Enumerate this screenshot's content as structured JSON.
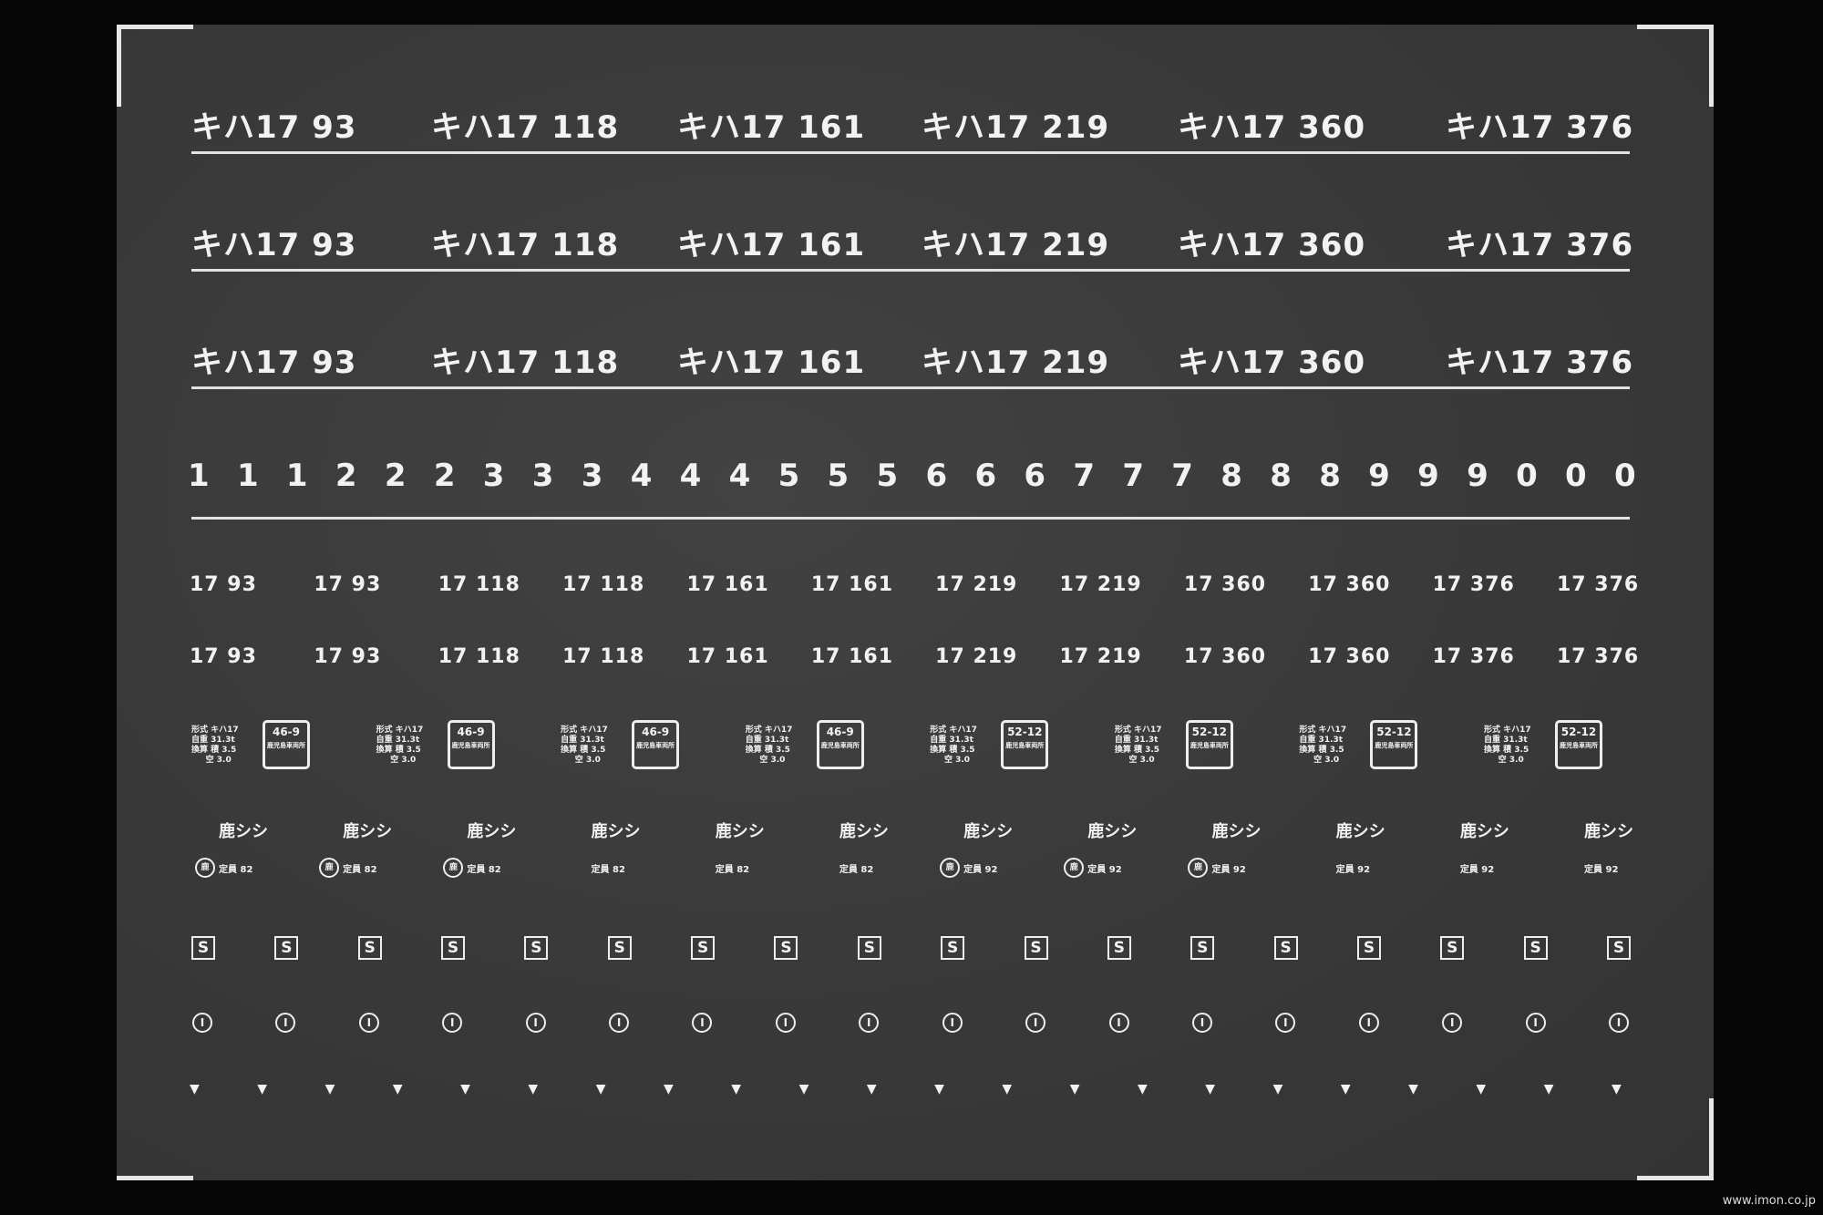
{
  "name_rows": [
    [
      "キハ17 93",
      "キハ17 118",
      "キハ17 161",
      "キハ17 219",
      "キハ17 360",
      "キハ17 376"
    ],
    [
      "キハ17 93",
      "キハ17 118",
      "キハ17 161",
      "キハ17 219",
      "キハ17 360",
      "キハ17 376"
    ],
    [
      "キハ17 93",
      "キハ17 118",
      "キハ17 161",
      "キハ17 219",
      "キハ17 360",
      "キハ17 376"
    ]
  ],
  "digits": [
    "1",
    "1",
    "1",
    "2",
    "2",
    "2",
    "3",
    "3",
    "3",
    "4",
    "4",
    "4",
    "5",
    "5",
    "5",
    "6",
    "6",
    "6",
    "7",
    "7",
    "7",
    "8",
    "8",
    "8",
    "9",
    "9",
    "9",
    "0",
    "0",
    "0"
  ],
  "small_rows": [
    [
      "17 93",
      "17 93",
      "17 118",
      "17 118",
      "17 161",
      "17 161",
      "17 219",
      "17 219",
      "17 360",
      "17 360",
      "17 376",
      "17 376"
    ],
    [
      "17 93",
      "17 93",
      "17 118",
      "17 118",
      "17 161",
      "17 161",
      "17 219",
      "17 219",
      "17 360",
      "17 360",
      "17 376",
      "17 376"
    ]
  ],
  "spec_plates": [
    {
      "text": "形式 キハ17\n自重 31.3t\n換算 積 3.5\n     空 3.0",
      "code": "46-9",
      "sub": "鹿児島車両所"
    },
    {
      "text": "形式 キハ17\n自重 31.3t\n換算 積 3.5\n     空 3.0",
      "code": "46-9",
      "sub": "鹿児島車両所"
    },
    {
      "text": "形式 キハ17\n自重 31.3t\n換算 積 3.5\n     空 3.0",
      "code": "46-9",
      "sub": "鹿児島車両所"
    },
    {
      "text": "形式 キハ17\n自重 31.3t\n換算 積 3.5\n     空 3.0",
      "code": "46-9",
      "sub": "鹿児島車両所"
    },
    {
      "text": "形式 キハ17\n自重 31.3t\n換算 積 3.5\n     空 3.0",
      "code": "52-12",
      "sub": "鹿児島車両所"
    },
    {
      "text": "形式 キハ17\n自重 31.3t\n換算 積 3.5\n     空 3.0",
      "code": "52-12",
      "sub": "鹿児島車両所"
    },
    {
      "text": "形式 キハ17\n自重 31.3t\n換算 積 3.5\n     空 3.0",
      "code": "52-12",
      "sub": "鹿児島車両所"
    },
    {
      "text": "形式 キハ17\n自重 31.3t\n換算 積 3.5\n     空 3.0",
      "code": "52-12",
      "sub": "鹿児島車両所"
    }
  ],
  "depot_marks": [
    "鹿シシ",
    "鹿シシ",
    "鹿シシ",
    "鹿シシ",
    "鹿シシ",
    "鹿シシ",
    "鹿シシ",
    "鹿シシ",
    "鹿シシ",
    "鹿シシ",
    "鹿シシ",
    "鹿シシ"
  ],
  "inspection_marks": [
    {
      "circle": "鹿",
      "text": "定員 82"
    },
    {
      "circle": "鹿",
      "text": "定員 82"
    },
    {
      "circle": "鹿",
      "text": "定員 82"
    },
    {
      "circle": "",
      "text": "定員 82"
    },
    {
      "circle": "",
      "text": "定員 82"
    },
    {
      "circle": "",
      "text": "定員 82"
    },
    {
      "circle": "鹿",
      "text": "定員 92"
    },
    {
      "circle": "鹿",
      "text": "定員 92"
    },
    {
      "circle": "鹿",
      "text": "定員 92"
    },
    {
      "circle": "",
      "text": "定員 92"
    },
    {
      "circle": "",
      "text": "定員 92"
    },
    {
      "circle": "",
      "text": "定員 92"
    }
  ],
  "s_marks": [
    "S",
    "S",
    "S",
    "S",
    "S",
    "S",
    "S",
    "S",
    "S",
    "S",
    "S",
    "S",
    "S",
    "S",
    "S",
    "S",
    "S",
    "S"
  ],
  "i_marks": [
    "I",
    "I",
    "I",
    "I",
    "I",
    "I",
    "I",
    "I",
    "I",
    "I",
    "I",
    "I",
    "I",
    "I",
    "I",
    "I",
    "I",
    "I"
  ],
  "triangles": [
    "▼",
    "▼",
    "▼",
    "▼",
    "▼",
    "▼",
    "▼",
    "▼",
    "▼",
    "▼",
    "▼",
    "▼",
    "▼",
    "▼",
    "▼",
    "▼",
    "▼",
    "▼",
    "▼",
    "▼",
    "▼",
    "▼"
  ],
  "credit": "www.imon.co.jp"
}
